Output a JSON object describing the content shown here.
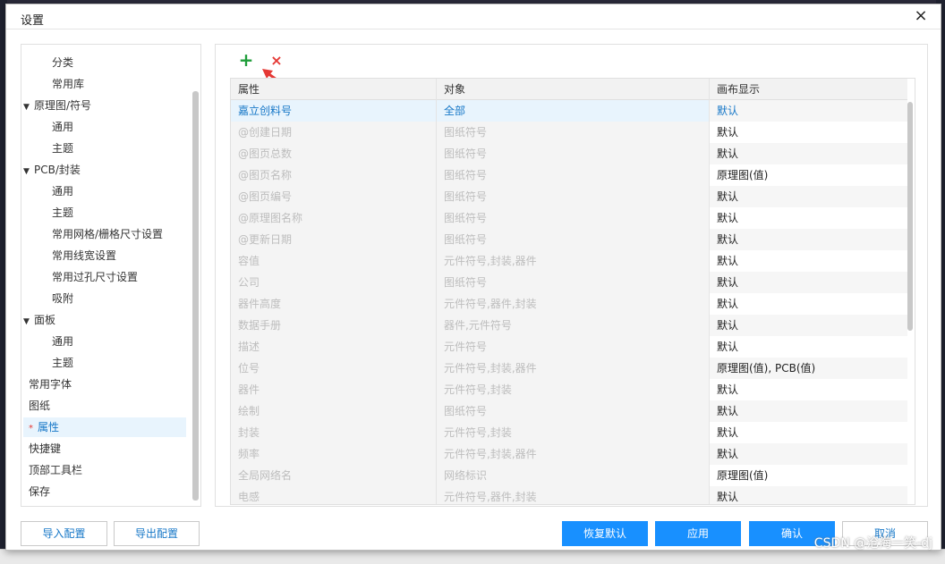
{
  "dialog": {
    "title": "设置",
    "close_glyph": "×"
  },
  "sidebar": {
    "items": [
      {
        "label": "分类",
        "level": 2
      },
      {
        "label": "常用库",
        "level": 2
      },
      {
        "label": "原理图/符号",
        "level": 1,
        "expanded": true
      },
      {
        "label": "通用",
        "level": 2
      },
      {
        "label": "主题",
        "level": 2
      },
      {
        "label": "PCB/封装",
        "level": 1,
        "expanded": true
      },
      {
        "label": "通用",
        "level": 2
      },
      {
        "label": "主题",
        "level": 2
      },
      {
        "label": "常用网格/栅格尺寸设置",
        "level": 2
      },
      {
        "label": "常用线宽设置",
        "level": 2
      },
      {
        "label": "常用过孔尺寸设置",
        "level": 2
      },
      {
        "label": "吸附",
        "level": 2
      },
      {
        "label": "面板",
        "level": 1,
        "expanded": true
      },
      {
        "label": "通用",
        "level": 2
      },
      {
        "label": "主题",
        "level": 2
      },
      {
        "label": "常用字体",
        "level": 0
      },
      {
        "label": "图纸",
        "level": 0
      },
      {
        "label": "属性",
        "level": 0,
        "active": true,
        "marker": "*"
      },
      {
        "label": "快捷键",
        "level": 0
      },
      {
        "label": "顶部工具栏",
        "level": 0
      },
      {
        "label": "保存",
        "level": 0
      }
    ]
  },
  "toolbar": {
    "add_glyph": "+",
    "delete_glyph": "×"
  },
  "table": {
    "columns": [
      "属性",
      "对象",
      "画布显示"
    ],
    "rows": [
      [
        "嘉立创料号",
        "全部",
        "默认"
      ],
      [
        "@创建日期",
        "图纸符号",
        "默认"
      ],
      [
        "@图页总数",
        "图纸符号",
        "默认"
      ],
      [
        "@图页名称",
        "图纸符号",
        "原理图(值)"
      ],
      [
        "@图页编号",
        "图纸符号",
        "默认"
      ],
      [
        "@原理图名称",
        "图纸符号",
        "默认"
      ],
      [
        "@更新日期",
        "图纸符号",
        "默认"
      ],
      [
        "容值",
        "元件符号,封装,器件",
        "默认"
      ],
      [
        "公司",
        "图纸符号",
        "默认"
      ],
      [
        "器件高度",
        "元件符号,器件,封装",
        "默认"
      ],
      [
        "数据手册",
        "器件,元件符号",
        "默认"
      ],
      [
        "描述",
        "元件符号",
        "默认"
      ],
      [
        "位号",
        "元件符号,封装,器件",
        "原理图(值), PCB(值)"
      ],
      [
        "器件",
        "元件符号,封装",
        "默认"
      ],
      [
        "绘制",
        "图纸符号",
        "默认"
      ],
      [
        "封装",
        "元件符号,封装",
        "默认"
      ],
      [
        "频率",
        "元件符号,封装,器件",
        "默认"
      ],
      [
        "全局网络名",
        "网络标识",
        "原理图(值)"
      ],
      [
        "电感",
        "元件符号,器件,封装",
        "默认"
      ]
    ]
  },
  "footer": {
    "import": "导入配置",
    "export": "导出配置",
    "restore": "恢复默认",
    "apply": "应用",
    "confirm": "确认",
    "cancel": "取消"
  },
  "watermark": "CSDN @沧海一笑-dj",
  "colors": {
    "primary": "#1890ff",
    "add": "#1f9d3a",
    "delete": "#e53935",
    "selected_text": "#1677c7"
  }
}
